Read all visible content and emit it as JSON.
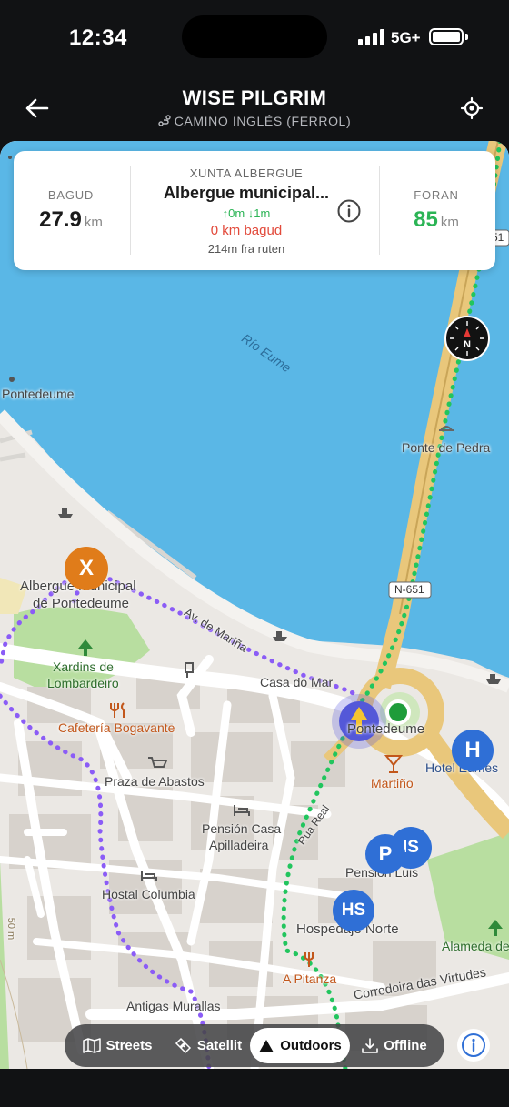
{
  "status": {
    "time": "12:34",
    "network": "5G+"
  },
  "header": {
    "title": "WISE PILGRIM",
    "subtitle": "CAMINO INGLÉS (FERROL)"
  },
  "card": {
    "behind_label": "BAGUD",
    "behind_value": "27.9",
    "behind_unit": "km",
    "eyebrow": "XUNTA ALBERGUE",
    "name": "Albergue municipal...",
    "elevation": "↑0m ↓1m",
    "behind_text": "0 km bagud",
    "distance_text": "214m fra ruten",
    "ahead_label": "FORAN",
    "ahead_value": "85",
    "ahead_unit": "km"
  },
  "map": {
    "labels": {
      "rio": "Río Eume",
      "pontedeume_west": "Pontedeume",
      "ponte_de_pedra": "Ponte de Pedra",
      "road_n651": "N-651",
      "road_n651_top": "51",
      "albergue_line1": "Albergue municipal",
      "albergue_line2": "de Pontedeume",
      "av_marina": "Av. de Mariña",
      "xardins_line1": "Xardins de",
      "xardins_line2": "Lombardeiro",
      "casa_do_mar": "Casa do Mar",
      "cafeteria": "Cafetería Bogavante",
      "pontedeume": "Pontedeume",
      "martino": "Martiño",
      "hotel_eumes": "Hotel Eumes",
      "praza": "Praza de Abastos",
      "pension_casa_line1": "Pensión Casa",
      "pension_casa_line2": "Apilladeira",
      "rua_real": "Rúa Real",
      "pension_luis": "Pensión Luis",
      "hostal_columbia": "Hostal Columbia",
      "hospedaje_norte": "Hospedaje Norte",
      "elevation_50": "50 m",
      "alameda": "Alameda de",
      "a_pitanza": "A Pitanza",
      "corredoira": "Corredoira das Virtudes",
      "antigas": "Antigas Murallas"
    },
    "markers": {
      "albergue_badge": "X",
      "hotel_badge": "H",
      "hostal_badge": "HS",
      "parking_badge": "P",
      "pension_badge": "IS",
      "compass_letter": "N"
    }
  },
  "layers": [
    {
      "label": "Streets",
      "icon": "map-icon",
      "active": false
    },
    {
      "label": "Satellit",
      "icon": "satellite-icon",
      "active": false
    },
    {
      "label": "Outdoors",
      "icon": "mountain-icon",
      "active": true
    },
    {
      "label": "Offline",
      "icon": "download-icon",
      "active": false
    }
  ],
  "colors": {
    "water": "#5ab7e6",
    "land": "#ebe8e4",
    "park": "#b8dea0",
    "route_purple": "#8b5cf6",
    "route_green": "#22c55e",
    "highway": "#e9c77b",
    "accent_orange": "#e07c1a",
    "accent_blue": "#2f6fd6"
  }
}
